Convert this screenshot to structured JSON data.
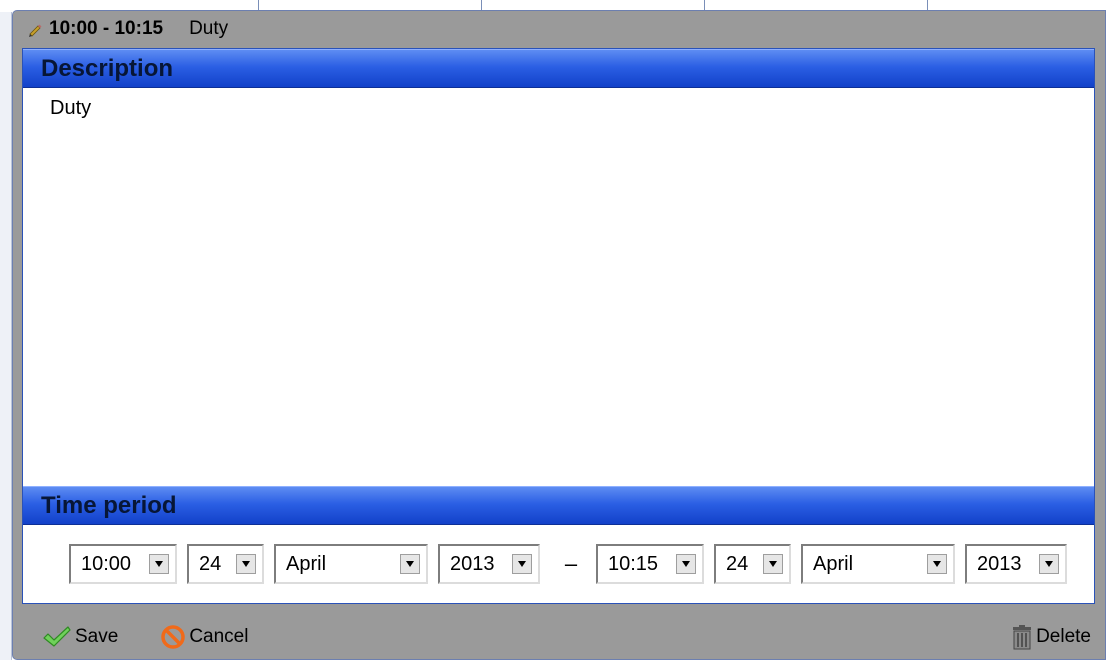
{
  "event": {
    "time_range": "10:00 - 10:15",
    "subject": "Duty"
  },
  "description": {
    "header": "Description",
    "text": "Duty"
  },
  "time_period": {
    "header": "Time period",
    "separator": "–",
    "start": {
      "time": "10:00",
      "day": "24",
      "month": "April",
      "year": "2013"
    },
    "end": {
      "time": "10:15",
      "day": "24",
      "month": "April",
      "year": "2013"
    }
  },
  "actions": {
    "save": "Save",
    "cancel": "Cancel",
    "delete": "Delete"
  },
  "icons": {
    "title": "pencil-icon",
    "save": "checkmark-icon",
    "cancel": "prohibited-icon",
    "delete": "trash-icon"
  },
  "colors": {
    "header_gradient_top": "#5d8cf2",
    "header_gradient_bottom": "#1241c9",
    "dialog_background": "#9a9a9a",
    "panel_border": "#2a52b8"
  }
}
